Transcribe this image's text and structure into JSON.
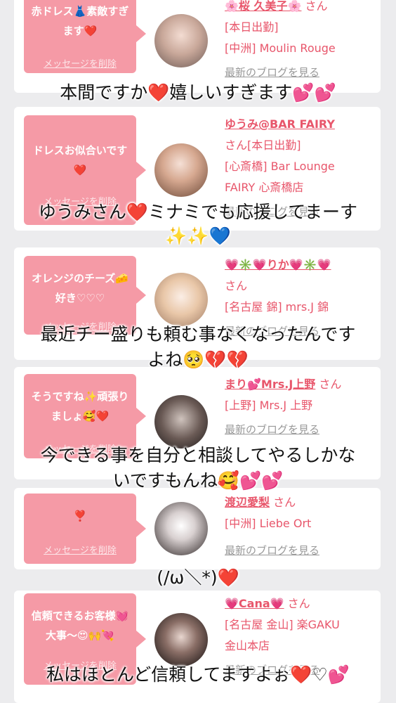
{
  "cards": [
    {
      "message": "赤ドレス👗素敵すぎます❤️",
      "delete_label": "メッセージを削除",
      "name": "🌸桜 久美子🌸",
      "san": "さん",
      "lines": [
        "[本日出勤]",
        "[中洲] Moulin Rouge"
      ],
      "blog": "最新のブログを見る"
    },
    {
      "message": "ドレスお似合いです❤️",
      "delete_label": "メッセージを削除",
      "name": "ゆうみ@BAR FAIRY",
      "san": "さん[本日出勤]",
      "lines": [
        "[心斎橋] Bar Lounge",
        "FAIRY 心斎橋店"
      ],
      "blog": "最新のブログを見る"
    },
    {
      "message": "オレンジのチーズ🧀好き♡♡♡",
      "delete_label": "メッセージを削除",
      "name": "💗✳️💗りか💗✳️💗",
      "san": "さん",
      "lines": [
        "[名古屋 錦] mrs.J 錦"
      ],
      "blog": "最新のブログを見る"
    },
    {
      "message": "そうですね✨頑張りましょ🥰❤️",
      "delete_label": "メッセージを削除",
      "name": "まり💕Mrs.J上野",
      "san": "さん",
      "lines": [
        "[上野] Mrs.J 上野"
      ],
      "blog": "最新のブログを見る"
    },
    {
      "message": "❣️",
      "delete_label": "メッセージを削除",
      "name": "渡辺愛梨",
      "san": "さん",
      "lines": [
        "[中洲] Liebe Ort"
      ],
      "blog": "最新のブログを見る"
    },
    {
      "message": "信頼できるお客様💓大事〜😍🙌💘",
      "delete_label": "メッセージを削除",
      "name": "💗Cana💗",
      "san": "さん",
      "lines": [
        "[名古屋 金山] 楽GAKU",
        "金山本店"
      ],
      "blog": "最新のブログを見る"
    }
  ],
  "captions": [
    "本間ですか❤️嬉しいすぎます💕💕",
    "ゆうみさん❤️ミナミでも応援してまーす",
    "✨✨💙",
    "最近チー盛りも頼む事なくなったんです",
    "よね🥺💔💔",
    "今できる事を自分と相談してやるしかな",
    "いですもんね🥰💕💕",
    "(/ω＼*)❤️",
    "私はほとんど信頼してますよぉ❤️♡💕"
  ]
}
